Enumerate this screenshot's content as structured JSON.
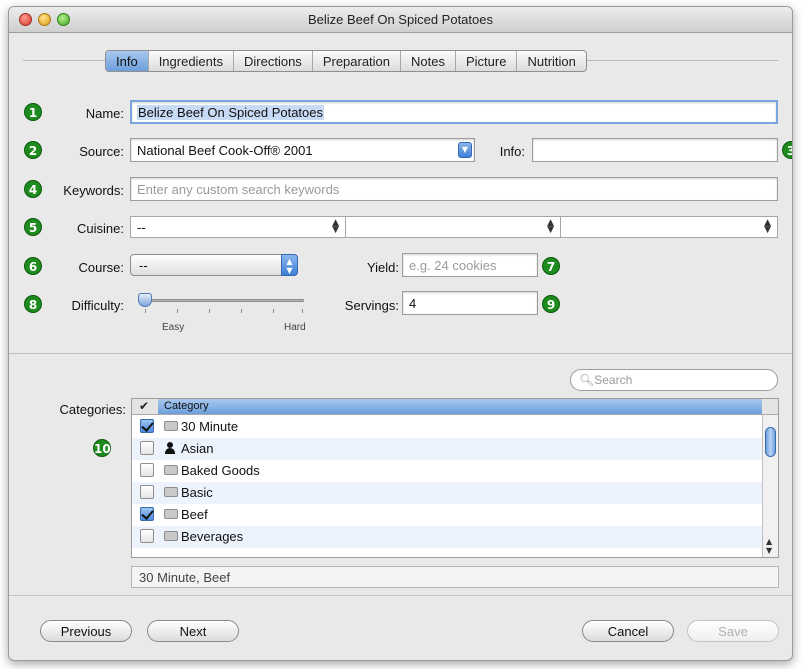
{
  "window": {
    "title": "Belize Beef On Spiced Potatoes"
  },
  "tabs": [
    "Info",
    "Ingredients",
    "Directions",
    "Preparation",
    "Notes",
    "Picture",
    "Nutrition"
  ],
  "active_tab": "Info",
  "badges": [
    "1",
    "2",
    "3",
    "4",
    "5",
    "6",
    "7",
    "8",
    "9",
    "10"
  ],
  "form": {
    "name_label": "Name:",
    "name_value": "Belize Beef On Spiced Potatoes",
    "source_label": "Source:",
    "source_value": "National Beef Cook-Off® 2001",
    "info_label": "Info:",
    "info_value": "",
    "keywords_label": "Keywords:",
    "keywords_placeholder": "Enter any custom search keywords",
    "cuisine_label": "Cuisine:",
    "cuisine_values": [
      "--",
      "",
      ""
    ],
    "course_label": "Course:",
    "course_value": "--",
    "yield_label": "Yield:",
    "yield_placeholder": "e.g. 24 cookies",
    "difficulty_label": "Difficulty:",
    "difficulty_min": "Easy",
    "difficulty_max": "Hard",
    "difficulty_level": 0,
    "servings_label": "Servings:",
    "servings_value": "4"
  },
  "categories": {
    "label": "Categories:",
    "search_placeholder": "Search",
    "header_check": "✔",
    "header_column": "Category",
    "rows": [
      {
        "label": "30 Minute",
        "checked": true,
        "icon": "category-icon"
      },
      {
        "label": "Asian",
        "checked": false,
        "icon": "person-icon"
      },
      {
        "label": "Baked Goods",
        "checked": false,
        "icon": "category-icon"
      },
      {
        "label": "Basic",
        "checked": false,
        "icon": "category-icon"
      },
      {
        "label": "Beef",
        "checked": true,
        "icon": "category-icon"
      },
      {
        "label": "Beverages",
        "checked": false,
        "icon": "category-icon"
      }
    ],
    "summary": "30 Minute, Beef"
  },
  "buttons": {
    "previous": "Previous",
    "next": "Next",
    "cancel": "Cancel",
    "save": "Save"
  },
  "colors": {
    "badge": "#1d8b1d",
    "selection": "#6c9fdb"
  }
}
